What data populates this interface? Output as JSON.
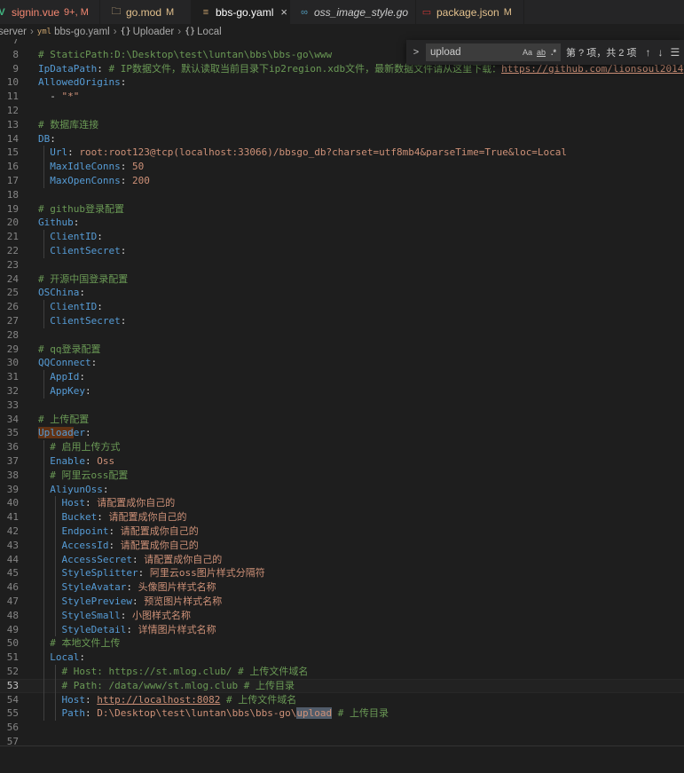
{
  "tabs": [
    {
      "label": "signin.vue",
      "status": "9+, M",
      "icon": "vue-icon",
      "glyph": "V",
      "color": "#f48771"
    },
    {
      "label": "go.mod",
      "status": "M",
      "icon": "go-mod-icon",
      "glyph": "🗀",
      "color": "#e2c08d"
    },
    {
      "label": "bbs-go.yaml",
      "status": "",
      "icon": "yaml-icon",
      "glyph": "≡",
      "color": "#cccccc",
      "close": "×"
    },
    {
      "label": "oss_image_style.go",
      "status": "",
      "icon": "go-icon",
      "glyph": "∞",
      "color": "#cccccc"
    },
    {
      "label": "package.json",
      "status": "M",
      "icon": "npm-icon",
      "glyph": "▭",
      "color": "#e2c08d"
    }
  ],
  "breadcrumb": {
    "items": [
      "server",
      "bbs-go.yaml",
      "Uploader",
      "Local"
    ],
    "yaml_glyph": "yml",
    "obj_glyph": "{}"
  },
  "find": {
    "value": "upload",
    "count": "第 ? 项，共 2 项",
    "opt_case": "Aa",
    "opt_word": "ab",
    "opt_regex": ".*",
    "toggle": ">",
    "up": "↑",
    "down": "↓",
    "menu": "☰"
  },
  "lines": [
    {
      "n": "7",
      "t": []
    },
    {
      "n": "8",
      "t": [
        {
          "c": "c",
          "v": "# StaticPath:D:\\Desktop\\test\\luntan\\bbs\\bbs-go\\www"
        }
      ]
    },
    {
      "n": "9",
      "t": [
        {
          "c": "k",
          "v": "IpDataPath"
        },
        {
          "c": "p",
          "v": ": "
        },
        {
          "c": "c",
          "v": "# IP数据文件，默认读取当前目录下ip2region.xdb文件，最新数据文件请从这里下载："
        },
        {
          "c": "u",
          "v": "https://github.com/lionsoul2014"
        }
      ]
    },
    {
      "n": "10",
      "t": [
        {
          "c": "k",
          "v": "AllowedOrigins"
        },
        {
          "c": "p",
          "v": ":"
        }
      ]
    },
    {
      "n": "11",
      "t": [
        {
          "c": "p",
          "v": "  - "
        },
        {
          "c": "s",
          "v": "\"*\""
        }
      ]
    },
    {
      "n": "12",
      "t": []
    },
    {
      "n": "13",
      "t": [
        {
          "c": "c",
          "v": "# 数据库连接"
        }
      ]
    },
    {
      "n": "14",
      "t": [
        {
          "c": "k",
          "v": "DB"
        },
        {
          "c": "p",
          "v": ":"
        }
      ]
    },
    {
      "n": "15",
      "t": [
        {
          "c": "p",
          "v": "  "
        },
        {
          "c": "k",
          "v": "Url"
        },
        {
          "c": "p",
          "v": ": "
        },
        {
          "c": "s",
          "v": "root:root123@tcp(localhost:33066)/bbsgo_db?charset=utf8mb4&parseTime=True&loc=Local"
        }
      ]
    },
    {
      "n": "16",
      "t": [
        {
          "c": "p",
          "v": "  "
        },
        {
          "c": "k",
          "v": "MaxIdleConns"
        },
        {
          "c": "p",
          "v": ": "
        },
        {
          "c": "s",
          "v": "50"
        }
      ]
    },
    {
      "n": "17",
      "t": [
        {
          "c": "p",
          "v": "  "
        },
        {
          "c": "k",
          "v": "MaxOpenConns"
        },
        {
          "c": "p",
          "v": ": "
        },
        {
          "c": "s",
          "v": "200"
        }
      ]
    },
    {
      "n": "18",
      "t": []
    },
    {
      "n": "19",
      "t": [
        {
          "c": "c",
          "v": "# github登录配置"
        }
      ]
    },
    {
      "n": "20",
      "t": [
        {
          "c": "k",
          "v": "Github"
        },
        {
          "c": "p",
          "v": ":"
        }
      ]
    },
    {
      "n": "21",
      "t": [
        {
          "c": "p",
          "v": "  "
        },
        {
          "c": "k",
          "v": "ClientID"
        },
        {
          "c": "p",
          "v": ":"
        }
      ]
    },
    {
      "n": "22",
      "t": [
        {
          "c": "p",
          "v": "  "
        },
        {
          "c": "k",
          "v": "ClientSecret"
        },
        {
          "c": "p",
          "v": ":"
        }
      ]
    },
    {
      "n": "23",
      "t": []
    },
    {
      "n": "24",
      "t": [
        {
          "c": "c",
          "v": "# 开源中国登录配置"
        }
      ]
    },
    {
      "n": "25",
      "t": [
        {
          "c": "k",
          "v": "OSChina"
        },
        {
          "c": "p",
          "v": ":"
        }
      ]
    },
    {
      "n": "26",
      "t": [
        {
          "c": "p",
          "v": "  "
        },
        {
          "c": "k",
          "v": "ClientID"
        },
        {
          "c": "p",
          "v": ":"
        }
      ]
    },
    {
      "n": "27",
      "t": [
        {
          "c": "p",
          "v": "  "
        },
        {
          "c": "k",
          "v": "ClientSecret"
        },
        {
          "c": "p",
          "v": ":"
        }
      ]
    },
    {
      "n": "28",
      "t": []
    },
    {
      "n": "29",
      "t": [
        {
          "c": "c",
          "v": "# qq登录配置"
        }
      ]
    },
    {
      "n": "30",
      "t": [
        {
          "c": "k",
          "v": "QQConnect"
        },
        {
          "c": "p",
          "v": ":"
        }
      ]
    },
    {
      "n": "31",
      "t": [
        {
          "c": "p",
          "v": "  "
        },
        {
          "c": "k",
          "v": "AppId"
        },
        {
          "c": "p",
          "v": ":"
        }
      ]
    },
    {
      "n": "32",
      "t": [
        {
          "c": "p",
          "v": "  "
        },
        {
          "c": "k",
          "v": "AppKey"
        },
        {
          "c": "p",
          "v": ":"
        }
      ]
    },
    {
      "n": "33",
      "t": []
    },
    {
      "n": "34",
      "t": [
        {
          "c": "c",
          "v": "# 上传配置"
        }
      ]
    },
    {
      "n": "35",
      "t": [
        {
          "c": "k hl",
          "v": "Upload"
        },
        {
          "c": "k",
          "v": "er"
        },
        {
          "c": "p",
          "v": ":"
        }
      ]
    },
    {
      "n": "36",
      "t": [
        {
          "c": "p",
          "v": "  "
        },
        {
          "c": "c",
          "v": "# 启用上传方式"
        }
      ]
    },
    {
      "n": "37",
      "t": [
        {
          "c": "p",
          "v": "  "
        },
        {
          "c": "k",
          "v": "Enable"
        },
        {
          "c": "p",
          "v": ": "
        },
        {
          "c": "s",
          "v": "Oss"
        }
      ]
    },
    {
      "n": "38",
      "t": [
        {
          "c": "p",
          "v": "  "
        },
        {
          "c": "c",
          "v": "# 阿里云oss配置"
        }
      ]
    },
    {
      "n": "39",
      "t": [
        {
          "c": "p",
          "v": "  "
        },
        {
          "c": "k",
          "v": "AliyunOss"
        },
        {
          "c": "p",
          "v": ":"
        }
      ]
    },
    {
      "n": "40",
      "t": [
        {
          "c": "p",
          "v": "    "
        },
        {
          "c": "k",
          "v": "Host"
        },
        {
          "c": "p",
          "v": ": "
        },
        {
          "c": "s",
          "v": "请配置成你自己的"
        }
      ]
    },
    {
      "n": "41",
      "t": [
        {
          "c": "p",
          "v": "    "
        },
        {
          "c": "k",
          "v": "Bucket"
        },
        {
          "c": "p",
          "v": ": "
        },
        {
          "c": "s",
          "v": "请配置成你自己的"
        }
      ]
    },
    {
      "n": "42",
      "t": [
        {
          "c": "p",
          "v": "    "
        },
        {
          "c": "k",
          "v": "Endpoint"
        },
        {
          "c": "p",
          "v": ": "
        },
        {
          "c": "s",
          "v": "请配置成你自己的"
        }
      ]
    },
    {
      "n": "43",
      "t": [
        {
          "c": "p",
          "v": "    "
        },
        {
          "c": "k",
          "v": "AccessId"
        },
        {
          "c": "p",
          "v": ": "
        },
        {
          "c": "s",
          "v": "请配置成你自己的"
        }
      ]
    },
    {
      "n": "44",
      "t": [
        {
          "c": "p",
          "v": "    "
        },
        {
          "c": "k",
          "v": "AccessSecret"
        },
        {
          "c": "p",
          "v": ": "
        },
        {
          "c": "s",
          "v": "请配置成你自己的"
        }
      ]
    },
    {
      "n": "45",
      "t": [
        {
          "c": "p",
          "v": "    "
        },
        {
          "c": "k",
          "v": "StyleSplitter"
        },
        {
          "c": "p",
          "v": ": "
        },
        {
          "c": "s",
          "v": "阿里云oss图片样式分隔符"
        }
      ]
    },
    {
      "n": "46",
      "t": [
        {
          "c": "p",
          "v": "    "
        },
        {
          "c": "k",
          "v": "StyleAvatar"
        },
        {
          "c": "p",
          "v": ": "
        },
        {
          "c": "s",
          "v": "头像图片样式名称"
        }
      ]
    },
    {
      "n": "47",
      "t": [
        {
          "c": "p",
          "v": "    "
        },
        {
          "c": "k",
          "v": "StylePreview"
        },
        {
          "c": "p",
          "v": ": "
        },
        {
          "c": "s",
          "v": "预览图片样式名称"
        }
      ]
    },
    {
      "n": "48",
      "t": [
        {
          "c": "p",
          "v": "    "
        },
        {
          "c": "k",
          "v": "StyleSmall"
        },
        {
          "c": "p",
          "v": ": "
        },
        {
          "c": "s",
          "v": "小图样式名称"
        }
      ]
    },
    {
      "n": "49",
      "t": [
        {
          "c": "p",
          "v": "    "
        },
        {
          "c": "k",
          "v": "StyleDetail"
        },
        {
          "c": "p",
          "v": ": "
        },
        {
          "c": "s",
          "v": "详情图片样式名称"
        }
      ]
    },
    {
      "n": "50",
      "t": [
        {
          "c": "p",
          "v": "  "
        },
        {
          "c": "c",
          "v": "# 本地文件上传"
        }
      ]
    },
    {
      "n": "51",
      "t": [
        {
          "c": "p",
          "v": "  "
        },
        {
          "c": "k",
          "v": "Local"
        },
        {
          "c": "p",
          "v": ":"
        }
      ]
    },
    {
      "n": "52",
      "t": [
        {
          "c": "p",
          "v": "    "
        },
        {
          "c": "c",
          "v": "# Host: https://st.mlog.club/ # 上传文件域名"
        }
      ]
    },
    {
      "n": "53",
      "t": [
        {
          "c": "p",
          "v": "    "
        },
        {
          "c": "c",
          "v": "# Path: /data/www/st.mlog.club # 上传目录"
        }
      ],
      "current": true
    },
    {
      "n": "54",
      "t": [
        {
          "c": "p",
          "v": "    "
        },
        {
          "c": "k",
          "v": "Host"
        },
        {
          "c": "p",
          "v": ": "
        },
        {
          "c": "u",
          "v": "http://localhost:8082"
        },
        {
          "c": "p",
          "v": " "
        },
        {
          "c": "c",
          "v": "# 上传文件域名"
        }
      ]
    },
    {
      "n": "55",
      "t": [
        {
          "c": "p",
          "v": "    "
        },
        {
          "c": "k",
          "v": "Path"
        },
        {
          "c": "p",
          "v": ": "
        },
        {
          "c": "s",
          "v": "D:\\Desktop\\test\\luntan\\bbs\\bbs-go\\"
        },
        {
          "c": "s hl2",
          "v": "upload"
        },
        {
          "c": "p",
          "v": " "
        },
        {
          "c": "c",
          "v": "# 上传目录"
        }
      ]
    },
    {
      "n": "56",
      "t": []
    },
    {
      "n": "57",
      "t": []
    }
  ],
  "colors": {
    "keyword": "#569cd6",
    "string": "#ce9178",
    "comment": "#6a9955",
    "background": "#1e1e1e",
    "tabbar": "#252526"
  }
}
